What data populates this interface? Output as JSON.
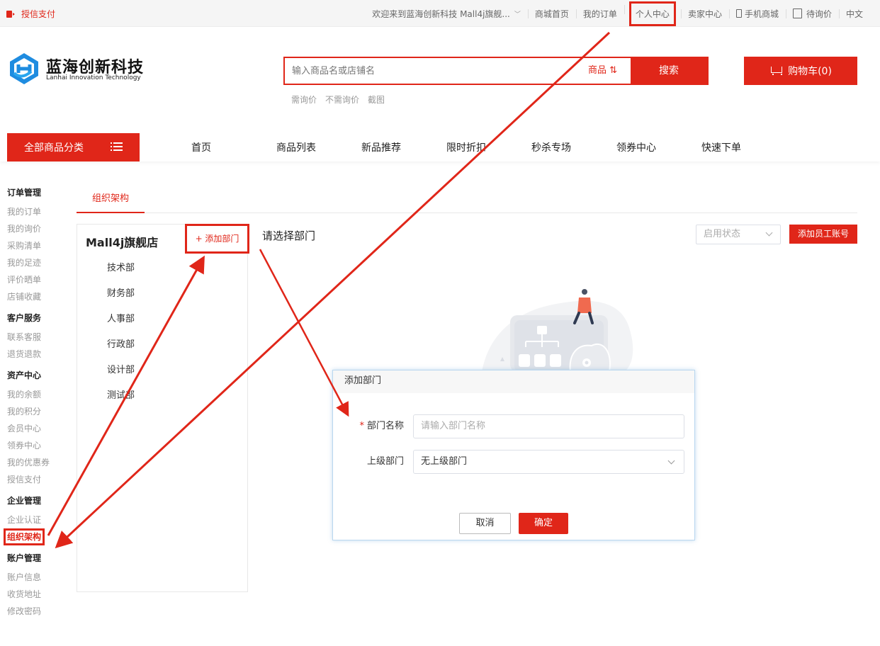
{
  "topbar": {
    "credit": "授信支付",
    "welcome": "欢迎来到蓝海创新科技 Mall4j旗舰...",
    "links": [
      "商城首页",
      "我的订单",
      "个人中心",
      "卖家中心",
      "手机商城",
      "待询价",
      "中文"
    ]
  },
  "brand": {
    "name": "蓝海创新科技",
    "subtitle": "Lanhai Innovation Technology"
  },
  "search": {
    "placeholder": "输入商品名或店铺名",
    "scope": "商品",
    "button": "搜索",
    "hot": [
      "需询价",
      "不需询价",
      "截图"
    ]
  },
  "cart": {
    "label": "购物车(0)"
  },
  "nav": {
    "all_categories": "全部商品分类",
    "links": [
      "首页",
      "商品列表",
      "新品推荐",
      "限时折扣",
      "秒杀专场",
      "领券中心",
      "快速下单"
    ]
  },
  "sidebar": [
    {
      "title": "订单管理",
      "items": [
        "我的订单",
        "我的询价",
        "采购清单",
        "我的足迹",
        "评价晒单",
        "店铺收藏"
      ]
    },
    {
      "title": "客户服务",
      "items": [
        "联系客服",
        "退货退款"
      ]
    },
    {
      "title": "资产中心",
      "items": [
        "我的余额",
        "我的积分",
        "会员中心",
        "领券中心",
        "我的优惠券",
        "授信支付"
      ]
    },
    {
      "title": "企业管理",
      "items": [
        "企业认证",
        "组织架构"
      ]
    },
    {
      "title": "账户管理",
      "items": [
        "账户信息",
        "收货地址",
        "修改密码"
      ]
    }
  ],
  "content": {
    "tab": "组织架构",
    "store_name": "Mall4j旗舰店",
    "add_dept": "+ 添加部门",
    "departments": [
      "技术部",
      "财务部",
      "人事部",
      "行政部",
      "设计部",
      "测试部"
    ],
    "choose_dept": "请选择部门",
    "status_placeholder": "启用状态",
    "add_staff": "添加员工账号"
  },
  "dialog": {
    "title": "添加部门",
    "name_label": "部门名称",
    "name_placeholder": "请输入部门名称",
    "parent_label": "上级部门",
    "parent_value": "无上级部门",
    "cancel": "取消",
    "confirm": "确定"
  },
  "colors": {
    "accent": "#e02619",
    "brand_blue": "#1f8ce0"
  }
}
